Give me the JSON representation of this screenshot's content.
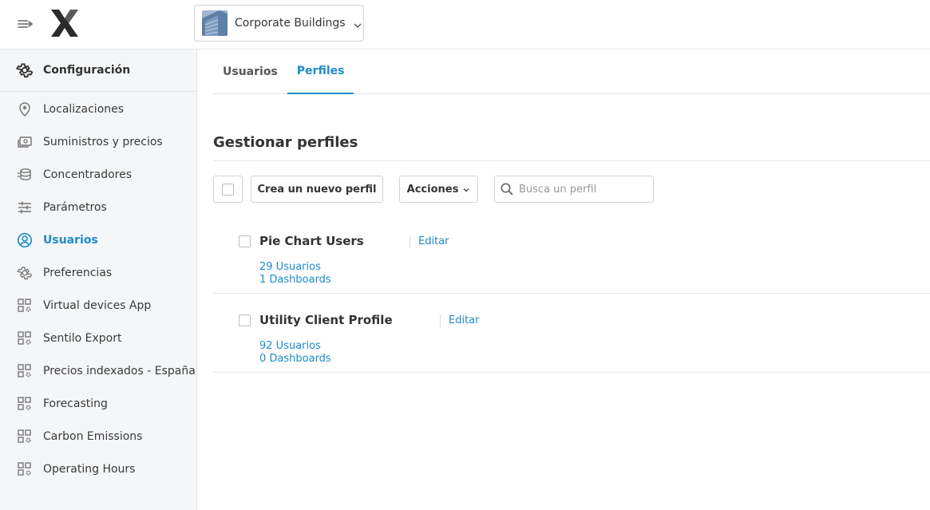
{
  "header": {
    "building": {
      "name": "Corporate Buildings"
    }
  },
  "sidebar": {
    "title": "Configuración",
    "items": [
      {
        "label": "Localizaciones",
        "icon": "map-pin-icon"
      },
      {
        "label": "Suministros y precios",
        "icon": "money-icon"
      },
      {
        "label": "Concentradores",
        "icon": "database-icon"
      },
      {
        "label": "Parámetros",
        "icon": "sliders-icon"
      },
      {
        "label": "Usuarios",
        "icon": "user-circle-icon",
        "active": true
      },
      {
        "label": "Preferencias",
        "icon": "gear-icon"
      },
      {
        "label": "Virtual devices App",
        "icon": "app-grid-gear-icon"
      },
      {
        "label": "Sentilo Export",
        "icon": "app-grid-gear-icon"
      },
      {
        "label": "Precios indexados - España",
        "icon": "app-grid-gear-icon"
      },
      {
        "label": "Forecasting",
        "icon": "app-grid-gear-icon"
      },
      {
        "label": "Carbon Emissions",
        "icon": "app-grid-gear-icon"
      },
      {
        "label": "Operating Hours",
        "icon": "app-grid-gear-icon"
      }
    ]
  },
  "tabs": [
    {
      "label": "Usuarios",
      "active": false
    },
    {
      "label": "Perfiles",
      "active": true
    }
  ],
  "main": {
    "title": "Gestionar perfiles",
    "new_profile_button": "Crea un nuevo perfil",
    "actions_button": "Acciones",
    "search_placeholder": "Busca un perfil"
  },
  "profiles": [
    {
      "name": "Pie Chart Users",
      "edit": "Editar",
      "users": "29 Usuarios",
      "dashboards": "1 Dashboards"
    },
    {
      "name": "Utility Client Profile",
      "edit": "Editar",
      "users": "92 Usuarios",
      "dashboards": "0 Dashboards"
    }
  ],
  "colors": {
    "accent": "#1d8cc8",
    "sidebar_bg": "#f4f6f8",
    "border": "#e3e6ea"
  }
}
